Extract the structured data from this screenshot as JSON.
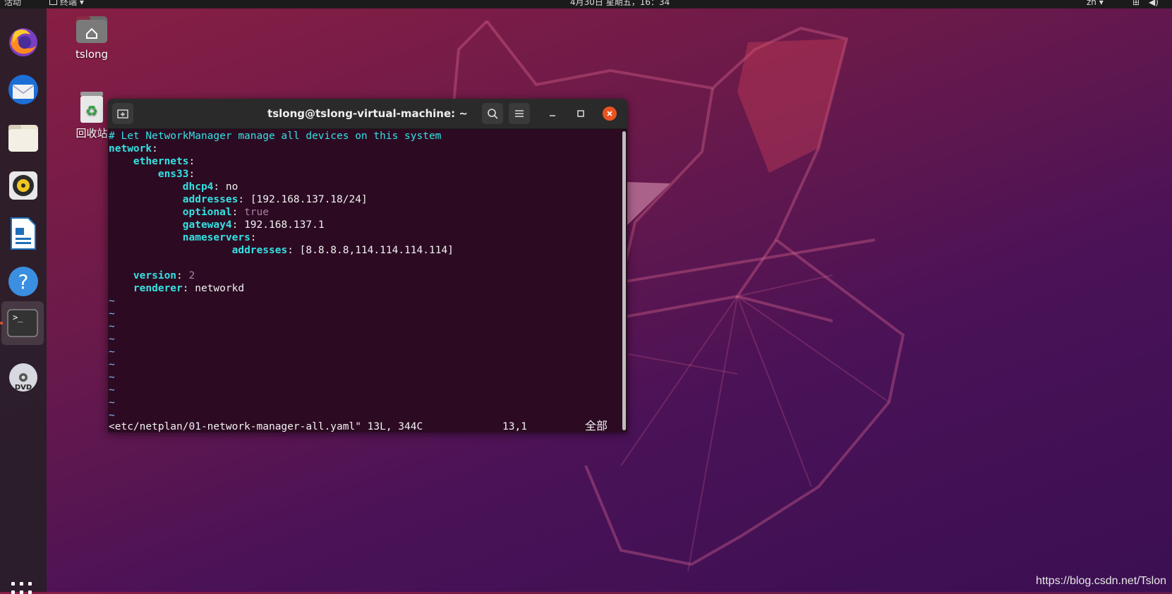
{
  "topbar": {
    "activities": "活动",
    "app_menu": "终端 ▾",
    "clock": "4月30日 星期五，16：34",
    "input_method": "zh ▾",
    "status_icons": [
      "network-icon",
      "volume-icon"
    ]
  },
  "dock": {
    "items": [
      "firefox-icon",
      "thunderbird-icon",
      "files-icon",
      "rhythmbox-icon",
      "writer-icon",
      "help-icon",
      "terminal-icon",
      "dvd-icon"
    ],
    "active_index": 6
  },
  "desktop": {
    "home_label": "tslong",
    "trash_label": "回收站"
  },
  "terminal": {
    "title": "tslong@tslong-virtual-machine: ~",
    "lines": {
      "comment": "# Let NetworkManager manage all devices on this system",
      "network_key": "network",
      "ethernets_key": "ethernets",
      "ens33_key": "ens33",
      "dhcp4_key": "dhcp4",
      "dhcp4_val": "no",
      "addresses_key": "addresses",
      "addresses_val": "[192.168.137.18/24]",
      "optional_key": "optional",
      "optional_val": "true",
      "gateway4_key": "gateway4",
      "gateway4_val": "192.168.137.1",
      "nameservers_key": "nameservers",
      "ns_addresses_key": "addresses",
      "ns_addresses_val": "[8.8.8.8,114.114.114.114]",
      "version_key": "version",
      "version_val": "2",
      "renderer_key": "renderer",
      "renderer_val": "networkd"
    },
    "tilde": "~",
    "status": {
      "file": "<etc/netplan/01-network-manager-all.yaml\" 13L, 344C",
      "position": "13,1",
      "scroll": "全部"
    }
  },
  "watermark": "https://blog.csdn.net/Tslon",
  "colors": {
    "accent": "#e95420",
    "term_bg": "#2c0b22",
    "yaml_key": "#34e2e2",
    "yaml_number": "#ad7fa8"
  }
}
